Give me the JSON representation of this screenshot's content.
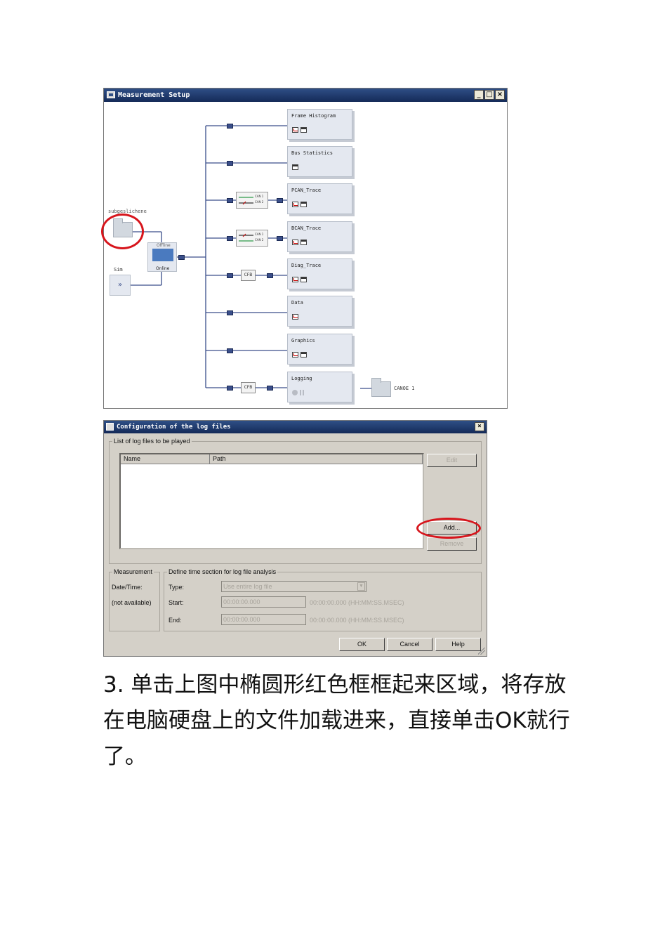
{
  "measurement_window": {
    "title": "Measurement Setup",
    "btn_min": "_",
    "btn_max": "□",
    "btn_close": "×",
    "blocks": [
      {
        "title": "Frame Histogram"
      },
      {
        "title": "Bus Statistics"
      },
      {
        "title": "PCAN_Trace"
      },
      {
        "title": "BCAN_Trace"
      },
      {
        "title": "Diag_Trace"
      },
      {
        "title": "Data"
      },
      {
        "title": "Graphics"
      },
      {
        "title": "Logging"
      }
    ],
    "source_label": "subgeslichene",
    "switch": {
      "offline": "Offline",
      "online": "Online"
    },
    "sim_label": "Sim",
    "sim_symbol": "»",
    "cfb1": "CFB",
    "cfb2": "CFB",
    "can1": "CAN 1",
    "can2": "CAN 2",
    "canoe_label": "CANOE 1",
    "highlight_color": "#d7151c"
  },
  "config_dialog": {
    "title": "Configuration of the log files",
    "close": "×",
    "list_group": "List of log files to be played",
    "col_name": "Name",
    "col_path": "Path",
    "btn_edit": "Edit",
    "btn_add": "Add...",
    "btn_remove": "Remove",
    "measurement_group": "Measurement",
    "date_time_label": "Date/Time:",
    "date_time_value": "(not available)",
    "time_group": "Define time section for log file analysis",
    "type_label": "Type:",
    "type_value": "Use entire log file",
    "start_label": "Start:",
    "start_value": "00:00:00.000",
    "start_hint": "00:00:00.000 (HH:MM:SS.MSEC)",
    "end_label": "End:",
    "end_value": "00:00:00.000",
    "end_hint": "00:00:00.000 (HH:MM:SS.MSEC)",
    "btn_ok": "OK",
    "btn_cancel": "Cancel",
    "btn_help": "Help"
  },
  "instruction": "3. 单击上图中椭圆形红色框框起来区域，将存放在电脑硬盘上的文件加载进来，直接单击OK就行了。"
}
